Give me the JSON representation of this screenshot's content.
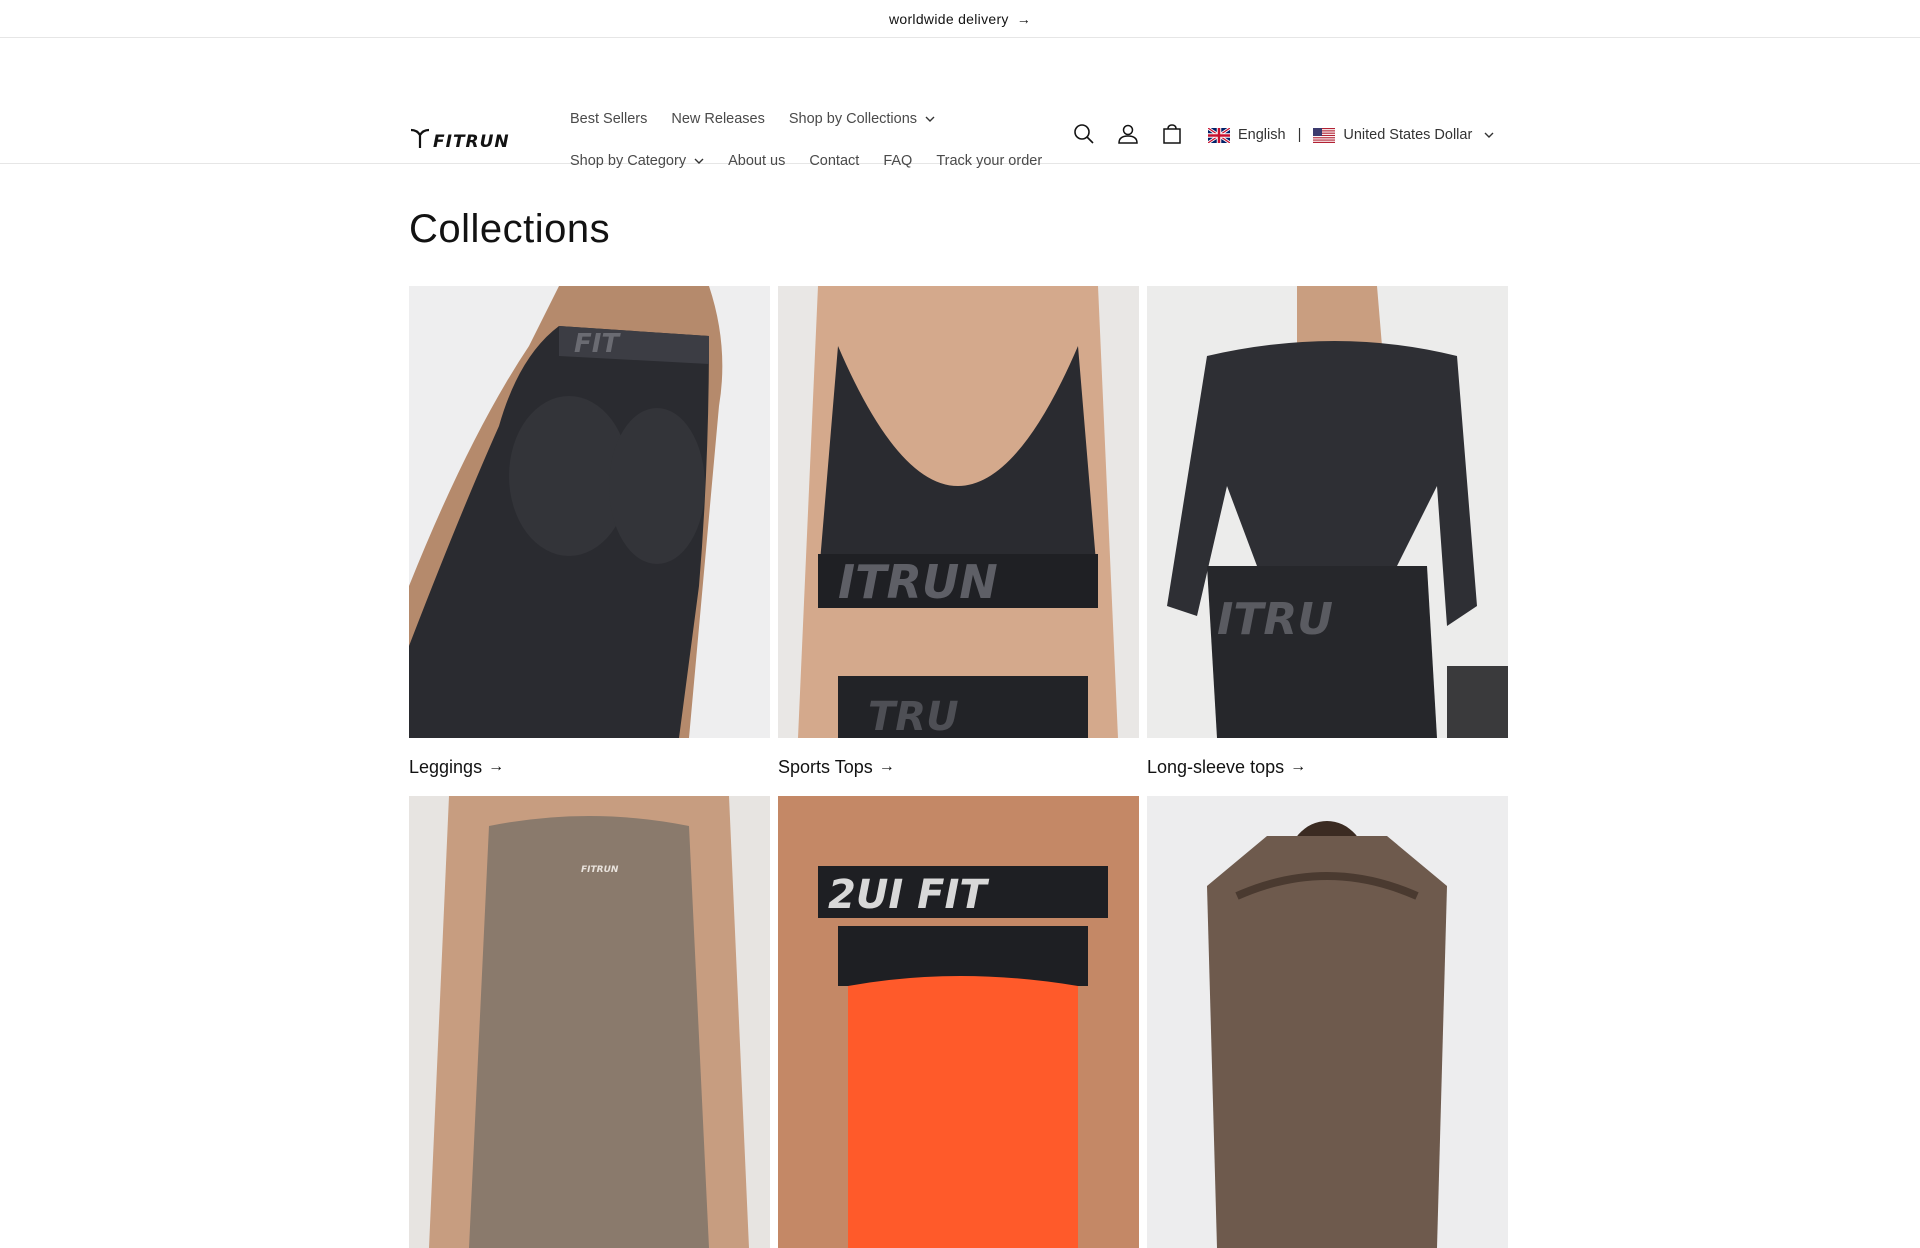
{
  "announcement": {
    "text": "worldwide delivery",
    "arrow": "→"
  },
  "header": {
    "logo_text": "FITRUN",
    "nav_row1": [
      {
        "label": "Best Sellers",
        "has_dropdown": false
      },
      {
        "label": "New Releases",
        "has_dropdown": false
      },
      {
        "label": "Shop by Collections",
        "has_dropdown": true
      }
    ],
    "nav_row2": [
      {
        "label": "Shop by Category",
        "has_dropdown": true
      },
      {
        "label": "About us",
        "has_dropdown": false
      },
      {
        "label": "Contact",
        "has_dropdown": false
      },
      {
        "label": "FAQ",
        "has_dropdown": false
      },
      {
        "label": "Track your order",
        "has_dropdown": false
      }
    ],
    "icons": [
      "search-icon",
      "account-icon",
      "cart-icon"
    ],
    "language": "English",
    "currency": "United States Dollar",
    "separator": "|"
  },
  "page": {
    "title": "Collections",
    "collections": [
      {
        "label": "Leggings",
        "image": "leggings"
      },
      {
        "label": "Sports Tops",
        "image": "sports-tops"
      },
      {
        "label": "Long-sleeve tops",
        "image": "long-sleeve-tops"
      },
      {
        "label": "",
        "image": "taupe-top"
      },
      {
        "label": "",
        "image": "bra-shorts"
      },
      {
        "label": "",
        "image": "mesh-longsleeve"
      }
    ]
  },
  "colors": {
    "text": "#121212",
    "nav_text": "#4a4a4a",
    "border": "#e6e6e6",
    "garment_black": "#2a2b30",
    "garment_taupe": "#8a7a6c"
  }
}
